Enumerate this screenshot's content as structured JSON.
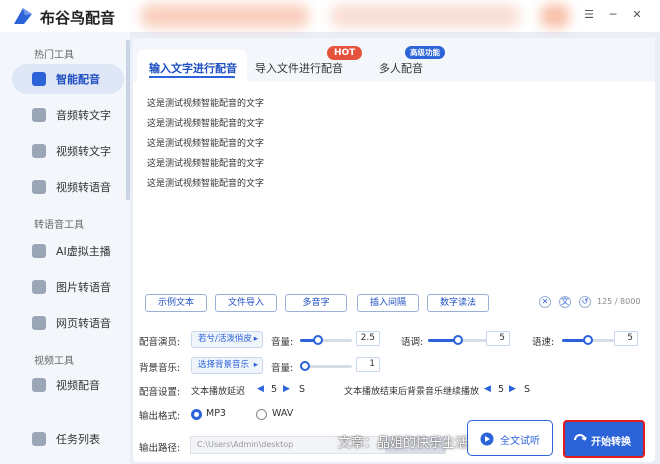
{
  "app": {
    "title": "布谷鸟配音"
  },
  "sidebar": {
    "sections": [
      "热门工具",
      "转语音工具",
      "视频工具"
    ],
    "items": [
      {
        "label": "智能配音"
      },
      {
        "label": "音频转文字"
      },
      {
        "label": "视频转文字"
      },
      {
        "label": "视频转语音"
      },
      {
        "label": "AI虚拟主播"
      },
      {
        "label": "图片转语音"
      },
      {
        "label": "网页转语音"
      },
      {
        "label": "视频配音"
      },
      {
        "label": "任务列表"
      }
    ]
  },
  "tabs": [
    {
      "label": "输入文字进行配音"
    },
    {
      "label": "导入文件进行配音",
      "badge": "HOT"
    },
    {
      "label": "多人配音",
      "badge": "高级功能"
    }
  ],
  "editor": {
    "lines": [
      "这是测试视频智能配音的文字",
      "这是测试视频智能配音的文字",
      "这是测试视频智能配音的文字",
      "这是测试视频智能配音的文字",
      "这是测试视频智能配音的文字"
    ]
  },
  "toolbar": {
    "buttons": [
      "示例文本",
      "文件导入",
      "多音字",
      "插入间隔",
      "数字读法"
    ],
    "count": "125 / 8000"
  },
  "voice": {
    "label": "配音演员:",
    "selected": "若兮/活泼俏皮",
    "volume_label": "音量:",
    "volume": "2.5",
    "volume_level": 0.35,
    "tone_label": "语调:",
    "tone": "5",
    "tone_level": 0.5,
    "speed_label": "语速:",
    "speed": "5",
    "speed_level": 0.5
  },
  "bgm": {
    "label": "背景音乐:",
    "selected": "选择背景音乐",
    "volume_label": "音量:",
    "volume": "1",
    "volume_level": 0.1
  },
  "settings": {
    "label": "配音设置:",
    "delay_label": "文本播放延迟",
    "delay": "5",
    "tail_label": "文本播放结束后背景音乐继续播放",
    "tail": "5"
  },
  "format": {
    "label": "输出格式:",
    "options": [
      "MP3",
      "WAV"
    ],
    "selected": "MP3"
  },
  "output": {
    "label": "输出路径:",
    "path": "C:\\Users\\Admin\\desktop",
    "change": "更改路径"
  },
  "actions": {
    "trial": "全文试听",
    "start": "开始转换"
  },
  "watermark": "文章：晶姐的快乐生活",
  "colors": {
    "accent": "#2b63d9",
    "hot": "#e5533d",
    "start_border": "#e01b1b"
  }
}
